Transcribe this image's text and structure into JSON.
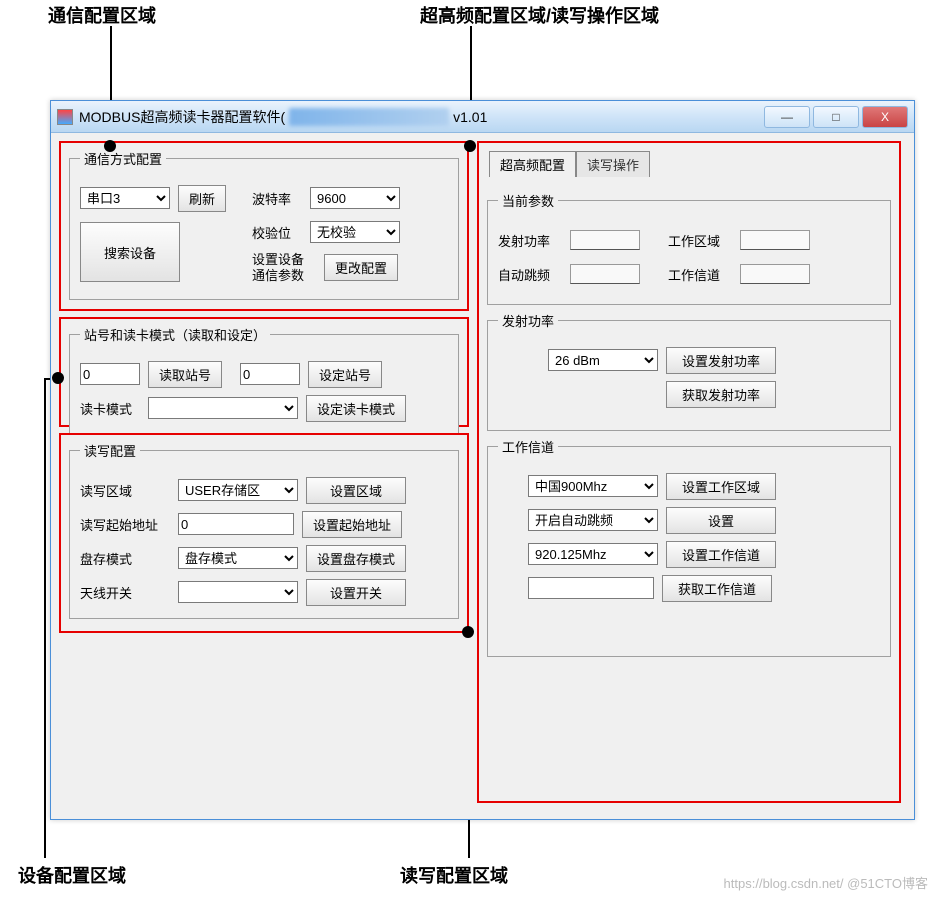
{
  "annotations": {
    "top_left": "通信配置区域",
    "top_right": "超高频配置区域/读写操作区域",
    "bottom_left": "设备配置区域",
    "bottom_right": "读写配置区域"
  },
  "titlebar": {
    "prefix": "MODBUS超高频读卡器配置软件(",
    "version": "v1.01",
    "min": "—",
    "max": "□",
    "close": "X"
  },
  "comm": {
    "legend": "通信方式配置",
    "port_value": "串口3",
    "refresh": "刷新",
    "search": "搜索设备",
    "baud_label": "波特率",
    "baud_value": "9600",
    "parity_label": "校验位",
    "parity_value": "无校验",
    "devparam_label": "设置设备通信参数",
    "change_config": "更改配置"
  },
  "station": {
    "legend": "站号和读卡模式（读取和设定）",
    "read_value": "0",
    "read_btn": "读取站号",
    "set_value": "0",
    "set_btn": "设定站号",
    "mode_label": "读卡模式",
    "mode_value": "",
    "mode_btn": "设定读卡模式"
  },
  "rw": {
    "legend": "读写配置",
    "area_label": "读写区域",
    "area_value": "USER存储区",
    "area_btn": "设置区域",
    "addr_label": "读写起始地址",
    "addr_value": "0",
    "addr_btn": "设置起始地址",
    "inv_label": "盘存模式",
    "inv_value": "盘存模式",
    "inv_btn": "设置盘存模式",
    "ant_label": "天线开关",
    "ant_value": "",
    "ant_btn": "设置开关"
  },
  "right": {
    "tab1": "超高频配置",
    "tab2": "读写操作",
    "current": {
      "legend": "当前参数",
      "tx_power": "发射功率",
      "work_area": "工作区域",
      "auto_hop": "自动跳频",
      "work_channel": "工作信道"
    },
    "tx": {
      "legend": "发射功率",
      "value": "26 dBm",
      "set": "设置发射功率",
      "get": "获取发射功率"
    },
    "ch": {
      "legend": "工作信道",
      "region_value": "中国900Mhz",
      "region_btn": "设置工作区域",
      "hop_value": "开启自动跳频",
      "hop_btn": "设置",
      "freq_value": "920.125Mhz",
      "freq_btn": "设置工作信道",
      "cur_value": "",
      "cur_btn": "获取工作信道"
    }
  },
  "credit": "https://blog.csdn.net/ @51CTO博客"
}
